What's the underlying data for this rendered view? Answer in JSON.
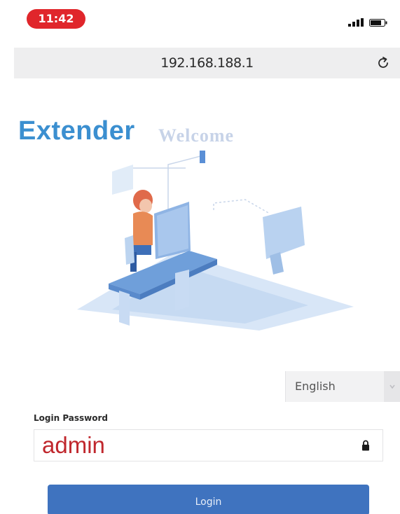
{
  "status_bar": {
    "time": "11:42",
    "time_badge_color": "#e0262b",
    "signal_icon": "signal-bars-icon",
    "battery_icon": "battery-icon"
  },
  "browser": {
    "address": "192.168.188.1",
    "reload_icon": "reload-icon"
  },
  "brand": {
    "title": "Extender",
    "subtitle": "Welcome",
    "title_color": "#3b8fd0"
  },
  "illustration": {
    "icon": "person-at-computer-illustration"
  },
  "language": {
    "selected": "English",
    "arrow_icon": "chevron-down-icon"
  },
  "login": {
    "password_label": "Login Password",
    "password_value": "admin",
    "password_color": "#c0272d",
    "lock_icon": "lock-icon",
    "button_label": "Login",
    "button_color": "#3f73bf"
  }
}
